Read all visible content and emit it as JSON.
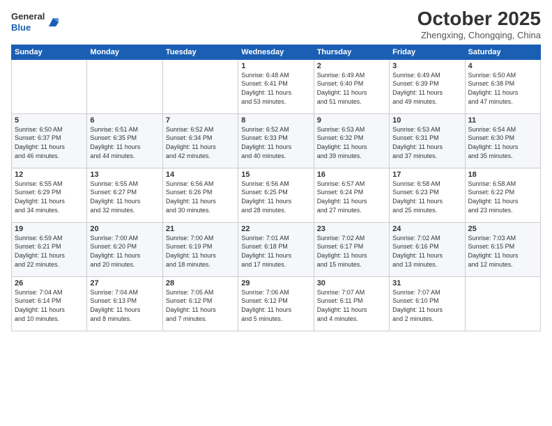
{
  "header": {
    "logo_general": "General",
    "logo_blue": "Blue",
    "month": "October 2025",
    "location": "Zhengxing, Chongqing, China"
  },
  "weekdays": [
    "Sunday",
    "Monday",
    "Tuesday",
    "Wednesday",
    "Thursday",
    "Friday",
    "Saturday"
  ],
  "weeks": [
    [
      {
        "day": "",
        "info": ""
      },
      {
        "day": "",
        "info": ""
      },
      {
        "day": "",
        "info": ""
      },
      {
        "day": "1",
        "info": "Sunrise: 6:48 AM\nSunset: 6:41 PM\nDaylight: 11 hours\nand 53 minutes."
      },
      {
        "day": "2",
        "info": "Sunrise: 6:49 AM\nSunset: 6:40 PM\nDaylight: 11 hours\nand 51 minutes."
      },
      {
        "day": "3",
        "info": "Sunrise: 6:49 AM\nSunset: 6:39 PM\nDaylight: 11 hours\nand 49 minutes."
      },
      {
        "day": "4",
        "info": "Sunrise: 6:50 AM\nSunset: 6:38 PM\nDaylight: 11 hours\nand 47 minutes."
      }
    ],
    [
      {
        "day": "5",
        "info": "Sunrise: 6:50 AM\nSunset: 6:37 PM\nDaylight: 11 hours\nand 46 minutes."
      },
      {
        "day": "6",
        "info": "Sunrise: 6:51 AM\nSunset: 6:35 PM\nDaylight: 11 hours\nand 44 minutes."
      },
      {
        "day": "7",
        "info": "Sunrise: 6:52 AM\nSunset: 6:34 PM\nDaylight: 11 hours\nand 42 minutes."
      },
      {
        "day": "8",
        "info": "Sunrise: 6:52 AM\nSunset: 6:33 PM\nDaylight: 11 hours\nand 40 minutes."
      },
      {
        "day": "9",
        "info": "Sunrise: 6:53 AM\nSunset: 6:32 PM\nDaylight: 11 hours\nand 39 minutes."
      },
      {
        "day": "10",
        "info": "Sunrise: 6:53 AM\nSunset: 6:31 PM\nDaylight: 11 hours\nand 37 minutes."
      },
      {
        "day": "11",
        "info": "Sunrise: 6:54 AM\nSunset: 6:30 PM\nDaylight: 11 hours\nand 35 minutes."
      }
    ],
    [
      {
        "day": "12",
        "info": "Sunrise: 6:55 AM\nSunset: 6:29 PM\nDaylight: 11 hours\nand 34 minutes."
      },
      {
        "day": "13",
        "info": "Sunrise: 6:55 AM\nSunset: 6:27 PM\nDaylight: 11 hours\nand 32 minutes."
      },
      {
        "day": "14",
        "info": "Sunrise: 6:56 AM\nSunset: 6:26 PM\nDaylight: 11 hours\nand 30 minutes."
      },
      {
        "day": "15",
        "info": "Sunrise: 6:56 AM\nSunset: 6:25 PM\nDaylight: 11 hours\nand 28 minutes."
      },
      {
        "day": "16",
        "info": "Sunrise: 6:57 AM\nSunset: 6:24 PM\nDaylight: 11 hours\nand 27 minutes."
      },
      {
        "day": "17",
        "info": "Sunrise: 6:58 AM\nSunset: 6:23 PM\nDaylight: 11 hours\nand 25 minutes."
      },
      {
        "day": "18",
        "info": "Sunrise: 6:58 AM\nSunset: 6:22 PM\nDaylight: 11 hours\nand 23 minutes."
      }
    ],
    [
      {
        "day": "19",
        "info": "Sunrise: 6:59 AM\nSunset: 6:21 PM\nDaylight: 11 hours\nand 22 minutes."
      },
      {
        "day": "20",
        "info": "Sunrise: 7:00 AM\nSunset: 6:20 PM\nDaylight: 11 hours\nand 20 minutes."
      },
      {
        "day": "21",
        "info": "Sunrise: 7:00 AM\nSunset: 6:19 PM\nDaylight: 11 hours\nand 18 minutes."
      },
      {
        "day": "22",
        "info": "Sunrise: 7:01 AM\nSunset: 6:18 PM\nDaylight: 11 hours\nand 17 minutes."
      },
      {
        "day": "23",
        "info": "Sunrise: 7:02 AM\nSunset: 6:17 PM\nDaylight: 11 hours\nand 15 minutes."
      },
      {
        "day": "24",
        "info": "Sunrise: 7:02 AM\nSunset: 6:16 PM\nDaylight: 11 hours\nand 13 minutes."
      },
      {
        "day": "25",
        "info": "Sunrise: 7:03 AM\nSunset: 6:15 PM\nDaylight: 11 hours\nand 12 minutes."
      }
    ],
    [
      {
        "day": "26",
        "info": "Sunrise: 7:04 AM\nSunset: 6:14 PM\nDaylight: 11 hours\nand 10 minutes."
      },
      {
        "day": "27",
        "info": "Sunrise: 7:04 AM\nSunset: 6:13 PM\nDaylight: 11 hours\nand 8 minutes."
      },
      {
        "day": "28",
        "info": "Sunrise: 7:05 AM\nSunset: 6:12 PM\nDaylight: 11 hours\nand 7 minutes."
      },
      {
        "day": "29",
        "info": "Sunrise: 7:06 AM\nSunset: 6:12 PM\nDaylight: 11 hours\nand 5 minutes."
      },
      {
        "day": "30",
        "info": "Sunrise: 7:07 AM\nSunset: 6:11 PM\nDaylight: 11 hours\nand 4 minutes."
      },
      {
        "day": "31",
        "info": "Sunrise: 7:07 AM\nSunset: 6:10 PM\nDaylight: 11 hours\nand 2 minutes."
      },
      {
        "day": "",
        "info": ""
      }
    ]
  ]
}
